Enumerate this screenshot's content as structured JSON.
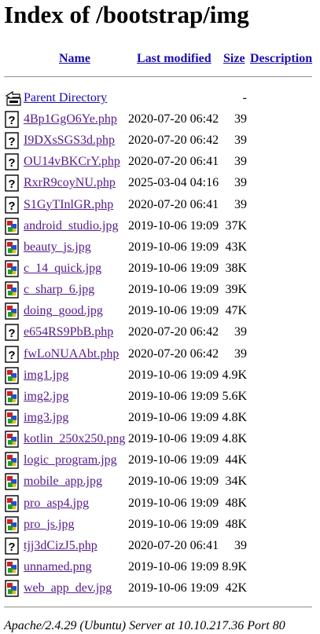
{
  "title": "Index of /bootstrap/img",
  "columns": {
    "name": "Name",
    "last_modified": "Last modified",
    "size": "Size",
    "description": "Description"
  },
  "parent": {
    "label": "Parent Directory",
    "size": "-",
    "icon": "back-icon"
  },
  "files": [
    {
      "name": "4Bp1GgO6Ye.php",
      "date": "2020-07-20 06:42",
      "size": "39",
      "icon": "unknown-file-icon",
      "visited": true
    },
    {
      "name": "I9DXsSGS3d.php",
      "date": "2020-07-20 06:42",
      "size": "39",
      "icon": "unknown-file-icon",
      "visited": true
    },
    {
      "name": "OU14vBKCrY.php",
      "date": "2020-07-20 06:41",
      "size": "39",
      "icon": "unknown-file-icon",
      "visited": true
    },
    {
      "name": "RxrR9coyNU.php",
      "date": "2025-03-04 04:16",
      "size": "39",
      "icon": "unknown-file-icon",
      "visited": true
    },
    {
      "name": "S1GyTInlGR.php",
      "date": "2020-07-20 06:41",
      "size": "39",
      "icon": "unknown-file-icon",
      "visited": true
    },
    {
      "name": "android_studio.jpg",
      "date": "2019-10-06 19:09",
      "size": "37K",
      "icon": "image-file-icon",
      "visited": true
    },
    {
      "name": "beauty_js.jpg",
      "date": "2019-10-06 19:09",
      "size": "43K",
      "icon": "image-file-icon",
      "visited": true
    },
    {
      "name": "c_14_quick.jpg",
      "date": "2019-10-06 19:09",
      "size": "38K",
      "icon": "image-file-icon",
      "visited": true
    },
    {
      "name": "c_sharp_6.jpg",
      "date": "2019-10-06 19:09",
      "size": "39K",
      "icon": "image-file-icon",
      "visited": true
    },
    {
      "name": "doing_good.jpg",
      "date": "2019-10-06 19:09",
      "size": "47K",
      "icon": "image-file-icon",
      "visited": true
    },
    {
      "name": "e654RS9PbB.php",
      "date": "2020-07-20 06:42",
      "size": "39",
      "icon": "unknown-file-icon",
      "visited": true
    },
    {
      "name": "fwLoNUAAbt.php",
      "date": "2020-07-20 06:42",
      "size": "39",
      "icon": "unknown-file-icon",
      "visited": true
    },
    {
      "name": "img1.jpg",
      "date": "2019-10-06 19:09",
      "size": "4.9K",
      "icon": "image-file-icon",
      "visited": true
    },
    {
      "name": "img2.jpg",
      "date": "2019-10-06 19:09",
      "size": "5.6K",
      "icon": "image-file-icon",
      "visited": true
    },
    {
      "name": "img3.jpg",
      "date": "2019-10-06 19:09",
      "size": "4.8K",
      "icon": "image-file-icon",
      "visited": true
    },
    {
      "name": "kotlin_250x250.png",
      "date": "2019-10-06 19:09",
      "size": "4.8K",
      "icon": "image-file-icon",
      "visited": true
    },
    {
      "name": "logic_program.jpg",
      "date": "2019-10-06 19:09",
      "size": "44K",
      "icon": "image-file-icon",
      "visited": true
    },
    {
      "name": "mobile_app.jpg",
      "date": "2019-10-06 19:09",
      "size": "34K",
      "icon": "image-file-icon",
      "visited": true
    },
    {
      "name": "pro_asp4.jpg",
      "date": "2019-10-06 19:09",
      "size": "48K",
      "icon": "image-file-icon",
      "visited": true
    },
    {
      "name": "pro_js.jpg",
      "date": "2019-10-06 19:09",
      "size": "48K",
      "icon": "image-file-icon",
      "visited": true
    },
    {
      "name": "tjj3dCizJ5.php",
      "date": "2020-07-20 06:41",
      "size": "39",
      "icon": "unknown-file-icon",
      "visited": true
    },
    {
      "name": "unnamed.png",
      "date": "2019-10-06 19:09",
      "size": "8.9K",
      "icon": "image-file-icon",
      "visited": true
    },
    {
      "name": "web_app_dev.jpg",
      "date": "2019-10-06 19:09",
      "size": "42K",
      "icon": "image-file-icon",
      "visited": true
    }
  ],
  "footer": "Apache/2.4.29 (Ubuntu) Server at 10.10.217.36 Port 80",
  "colors": {
    "link_unvisited": "#1a0dab",
    "link_visited": "#551a8b"
  }
}
